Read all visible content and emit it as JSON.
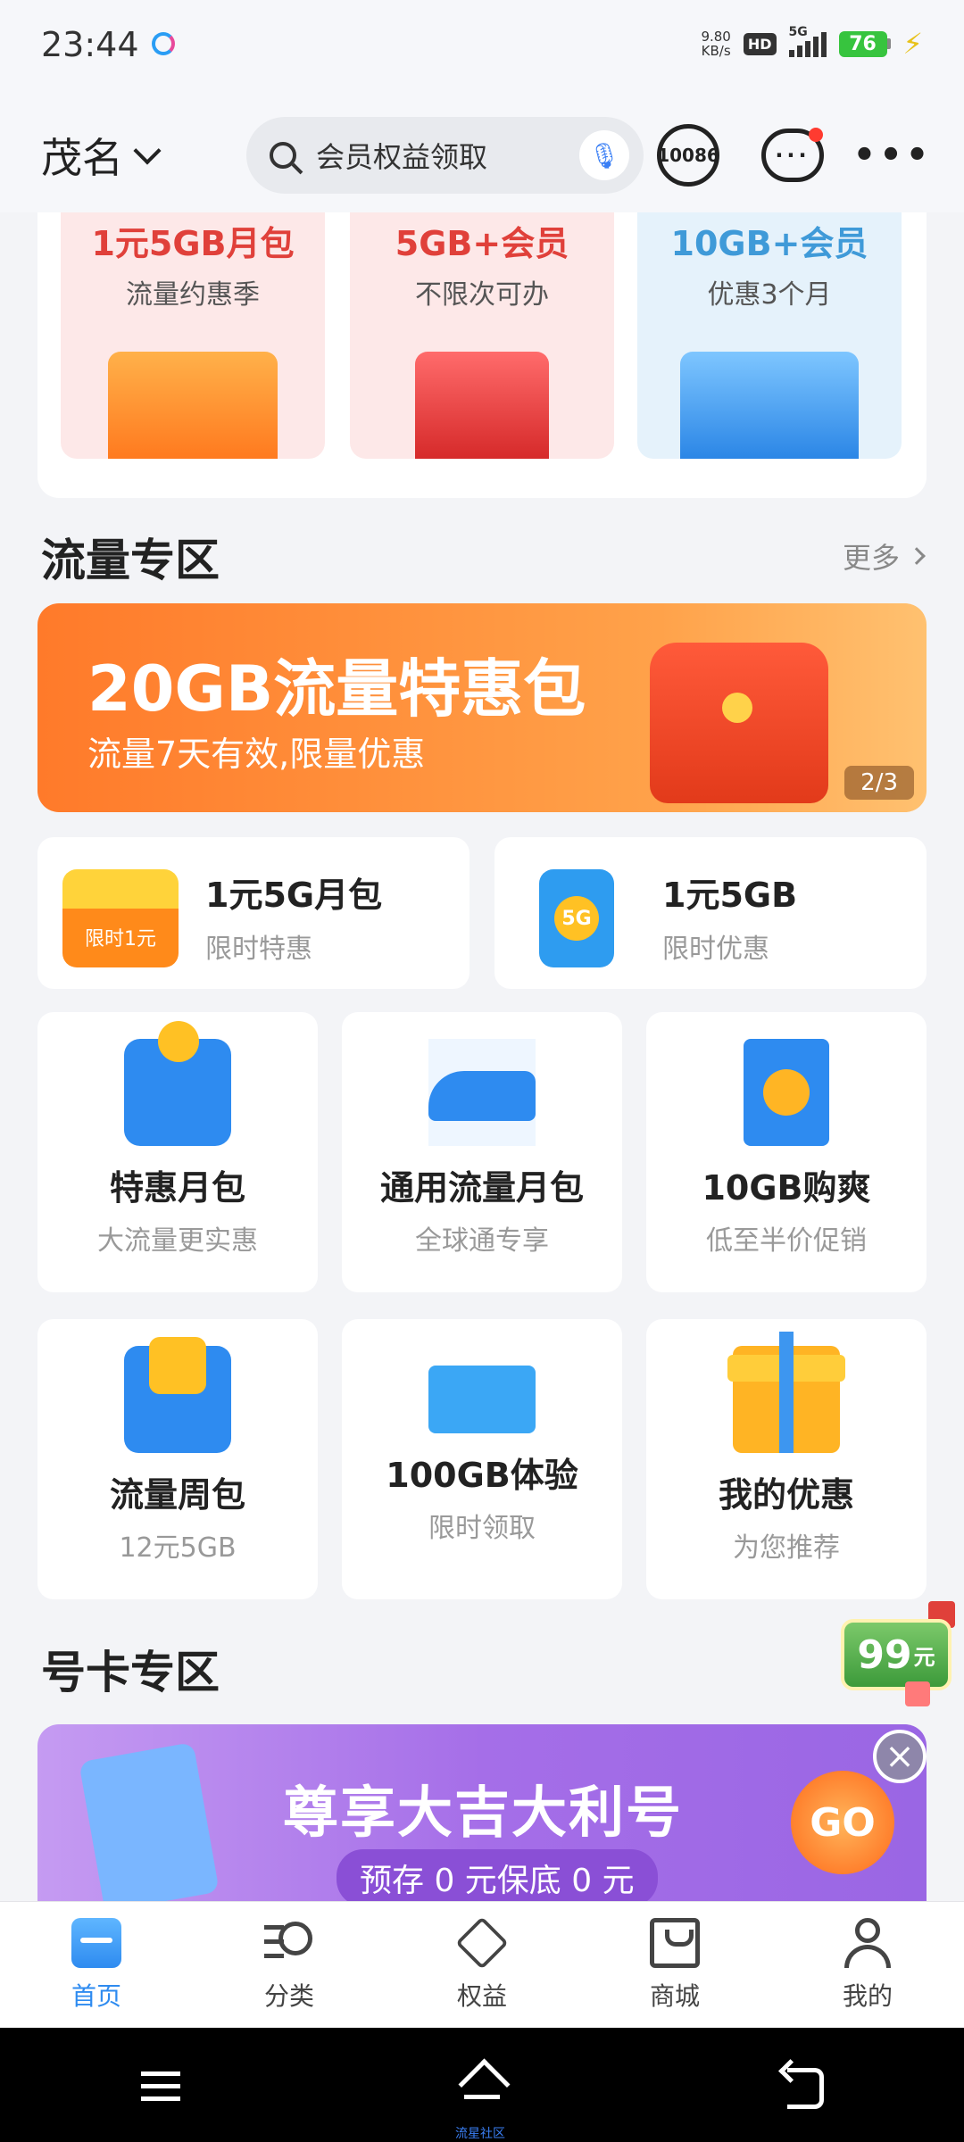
{
  "status_bar": {
    "time": "23:44",
    "net_speed_value": "9.80",
    "net_speed_unit": "KB/s",
    "hd": "HD",
    "signal_label": "5G",
    "battery": "76"
  },
  "header": {
    "city": "茂名",
    "search_placeholder": "会员权益领取",
    "service_number": "10086"
  },
  "promos": [
    {
      "title": "1元5GB月包",
      "subtitle": "流量约惠季"
    },
    {
      "title": "5GB+会员",
      "subtitle": "不限次可办"
    },
    {
      "title": "10GB+会员",
      "subtitle": "优惠3个月"
    }
  ],
  "traffic_section": {
    "title": "流量专区",
    "more": "更多",
    "banner": {
      "title": "20GB流量特惠包",
      "subtitle": "流量7天有效,限量优惠",
      "pager": "2/3"
    },
    "small_cards": [
      {
        "title": "1元5G月包",
        "subtitle": "限时特惠",
        "icon_text": "限时1元"
      },
      {
        "title": "1元5GB",
        "subtitle": "限时优惠",
        "icon_text": "5G"
      }
    ],
    "grid": [
      {
        "title": "特惠月包",
        "subtitle": "大流量更实惠"
      },
      {
        "title": "通用流量月包",
        "subtitle": "全球通专享"
      },
      {
        "title": "10GB购爽",
        "subtitle": "低至半价促销"
      },
      {
        "title": "流量周包",
        "subtitle": "12元5GB"
      },
      {
        "title": "100GB体验",
        "subtitle": "限时领取"
      },
      {
        "title": "我的优惠",
        "subtitle": "为您推荐"
      }
    ]
  },
  "float_badge": {
    "amount": "99",
    "unit": "元"
  },
  "card_section": {
    "title": "号卡专区",
    "banner": {
      "title": "尊享大吉大利号",
      "subtitle": "预存 0 元保底 0 元",
      "go": "GO"
    }
  },
  "tabbar": [
    {
      "label": "首页",
      "active": true
    },
    {
      "label": "分类",
      "active": false
    },
    {
      "label": "权益",
      "active": false
    },
    {
      "label": "商城",
      "active": false
    },
    {
      "label": "我的",
      "active": false
    }
  ],
  "sysnav": {
    "tiny_label": "流星社区"
  }
}
